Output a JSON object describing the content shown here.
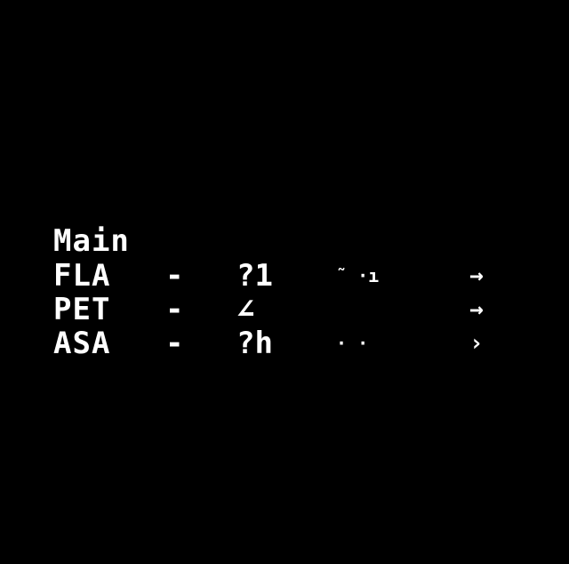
{
  "screen": {
    "background": "#000000",
    "foreground": "#ffffff"
  },
  "menu": {
    "title": "Main",
    "rows": [
      {
        "label": "FLA",
        "dash": "-",
        "value": "?1",
        "extra": "˜ ·ı",
        "arrow": "→"
      },
      {
        "label": "PET",
        "dash": "-",
        "value": "∠",
        "extra": "",
        "arrow": "→"
      },
      {
        "label": "ASA",
        "dash": "-",
        "value": "?h",
        "extra": "· ·",
        "arrow": "›"
      }
    ]
  }
}
